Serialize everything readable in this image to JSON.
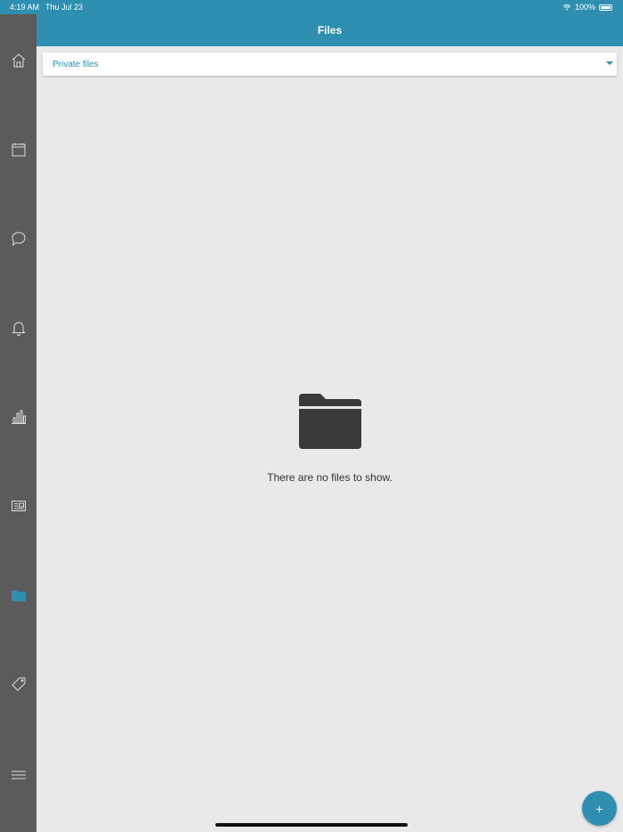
{
  "status_bar": {
    "time": "4:19 AM",
    "date": "Thu Jul 23",
    "battery": "100%"
  },
  "header": {
    "title": "Files"
  },
  "sidebar": {
    "items": [
      {
        "icon": "home-icon",
        "active": false
      },
      {
        "icon": "calendar-icon",
        "active": false
      },
      {
        "icon": "chat-icon",
        "active": false
      },
      {
        "icon": "bell-icon",
        "active": false
      },
      {
        "icon": "bar-chart-icon",
        "active": false
      },
      {
        "icon": "newspaper-icon",
        "active": false
      },
      {
        "icon": "folder-icon",
        "active": true
      },
      {
        "icon": "tag-icon",
        "active": false
      },
      {
        "icon": "menu-icon",
        "active": false
      }
    ]
  },
  "dropdown": {
    "selected": "Private files"
  },
  "empty_state": {
    "message": "There are no files to show.",
    "icon": "folder-icon"
  },
  "fab": {
    "label": "+"
  },
  "colors": {
    "accent": "#2f8fb0",
    "sidebar": "#5b5b5b",
    "background": "#e9e9e9"
  }
}
